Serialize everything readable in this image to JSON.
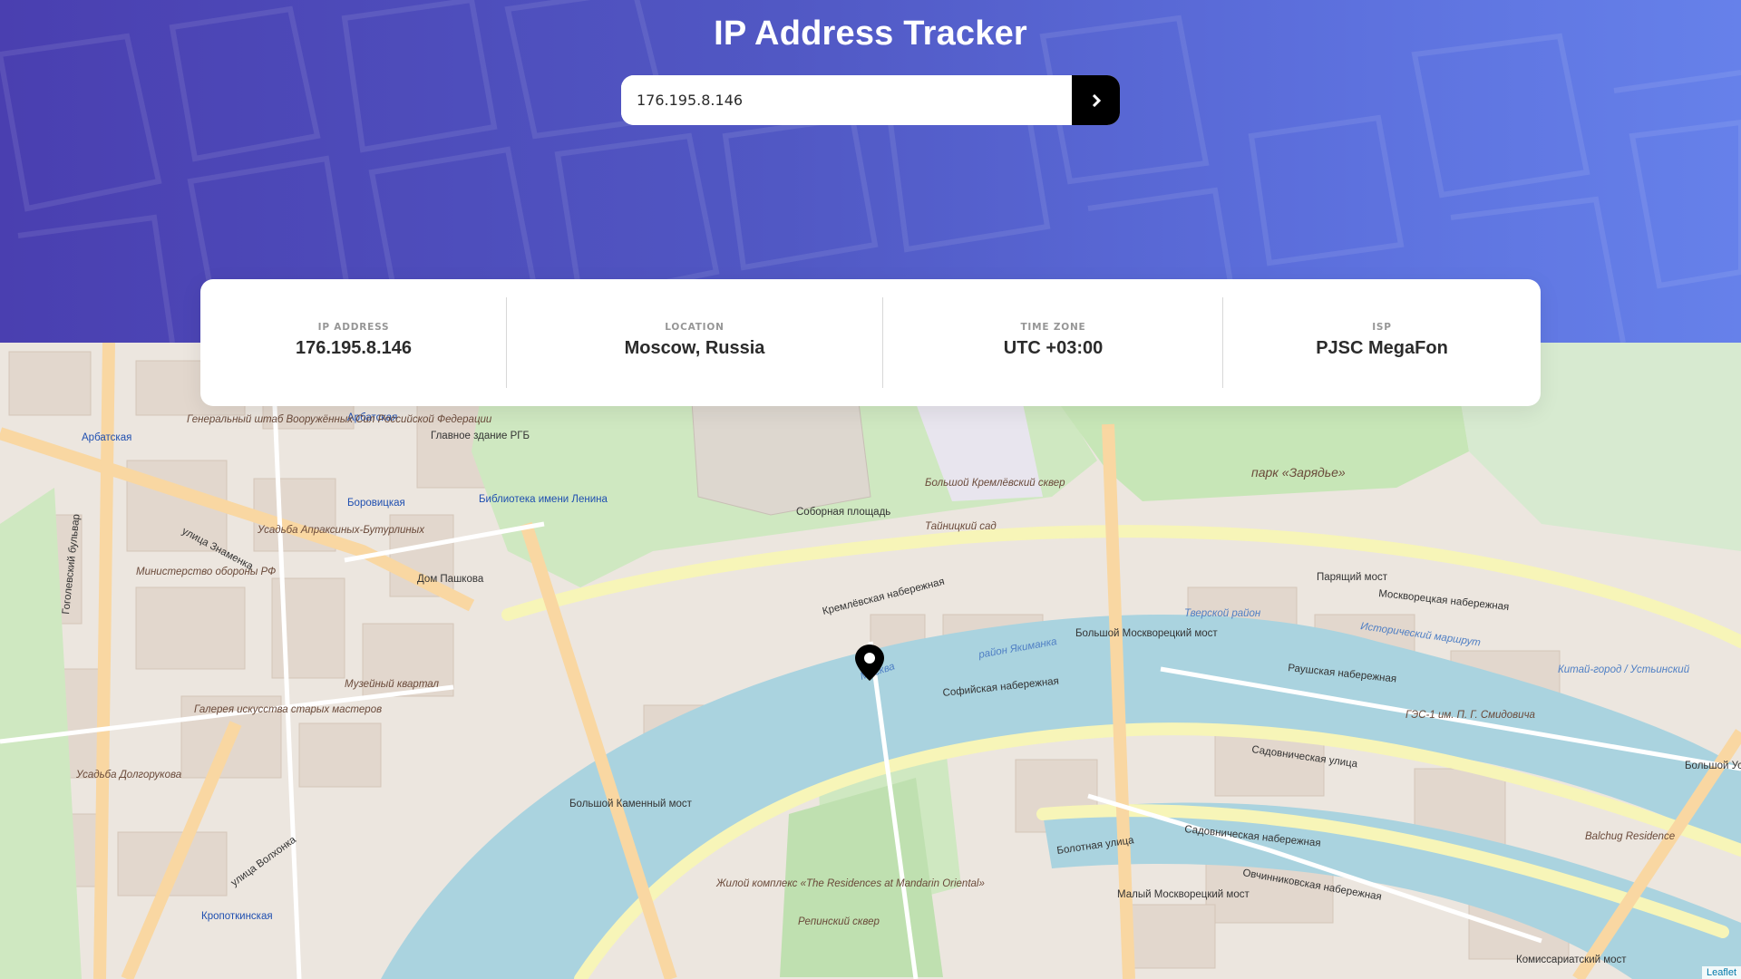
{
  "header": {
    "title": "IP Address Tracker",
    "search_value": "176.195.8.146",
    "submit_icon": "chevron-right-icon"
  },
  "info": {
    "ip": {
      "label": "IP ADDRESS",
      "value": "176.195.8.146"
    },
    "location": {
      "label": "LOCATION",
      "value": "Moscow, Russia"
    },
    "timezone": {
      "label": "TIME ZONE",
      "value": "UTC +03:00"
    },
    "isp": {
      "label": "ISP",
      "value": "PJSC MegaFon"
    }
  },
  "map": {
    "marker_icon": "location-pin-icon",
    "attribution": "Leaflet",
    "labels": {
      "arbatskaya": "Арбатская",
      "arbatskaya2": "Арбатская",
      "borovitskaya": "Боровицкая",
      "kropotkinskaya": "Кропоткинская",
      "genshtab": "Генеральный штаб Вооружённых Сил Российской Федерации",
      "minoborony": "Министерство обороны РФ",
      "rgb": "Главное здание РГБ",
      "biblioteka": "Библиотека имени Ленина",
      "sobornaya": "Соборная площадь",
      "kremlin_garden": "Большой Кремлёвский сквер",
      "tainitsky": "Тайницкий сад",
      "zaryadye": "парк «Зарядье»",
      "paryaschiy": "Парящий мост",
      "bolshoy_moskv": "Большой Москворецкий мост",
      "bolshoy_kamenny": "Большой Каменный мост",
      "maly_moskv": "Малый Москворецкий мост",
      "ustinsky": "Большой Устьинский мост",
      "komissariatsky": "Комиссариатский мост",
      "kremlevskaya_nab": "Кремлёвская набережная",
      "sofiyskaya_nab": "Софийская набережная",
      "raushskaya_nab": "Раушская набережная",
      "moskvoretskaya_nab": "Москворецкая набережная",
      "sadovnicheskaya": "Садовническая улица",
      "sadovnicheskaya_nab": "Садовническая набережная",
      "ovchinnikovskaya": "Овчинниковская набережная",
      "bolotnaya": "Болотная улица",
      "znamenka": "улица Знаменка",
      "volkhonka": "улица Волхонка",
      "moskva": "Москва",
      "dom_pashkova": "Дом Пашкова",
      "residences": "Жилой комплекс «The Residences at Mandarin Oriental»",
      "repinsky": "Репинский сквер",
      "gogolevsky": "Гоголевский бульвар",
      "tverskoy_rayon": "Тверской район",
      "yakimanka": "район Якиманка",
      "musey_kvartal": "Музейный квартал",
      "galereya": "Галерея искусства старых мастеров",
      "usadba_apraksinykh": "Усадьба Апраксиных-Бутурлиных",
      "usadba_dolgorukova": "Усадьба Долгорукова",
      "balchug": "Balchug Residence",
      "ges": "ГЭС-1 им. П. Г. Смидовича",
      "kitay_gorod": "Китай-город / Устьинский",
      "istorichesky": "Исторический маршрут"
    }
  }
}
